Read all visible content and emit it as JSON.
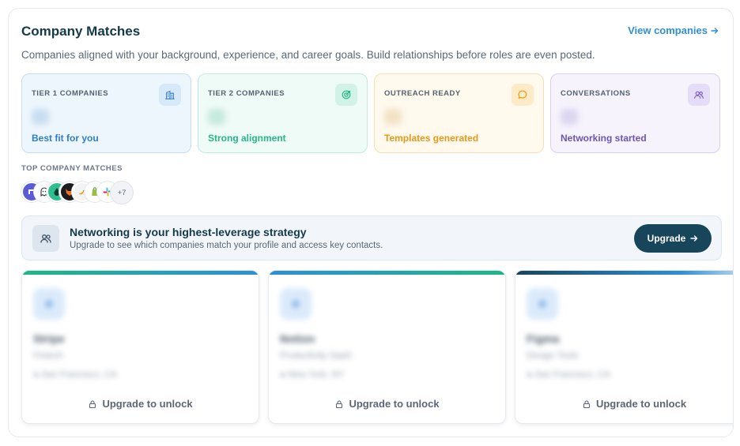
{
  "header": {
    "title": "Company Matches",
    "view_link": "View companies",
    "subtitle": "Companies aligned with your background, experience, and career goals. Build relationships before roles are even posted."
  },
  "stats": [
    {
      "label": "TIER 1 COMPANIES",
      "caption": "Best fit for you",
      "icon": "building-icon",
      "color": "#2d7fc4"
    },
    {
      "label": "TIER 2 COMPANIES",
      "caption": "Strong alignment",
      "icon": "target-icon",
      "color": "#26b886"
    },
    {
      "label": "OUTREACH READY",
      "caption": "Templates generated",
      "icon": "chat-bubble-icon",
      "color": "#e39a1a"
    },
    {
      "label": "CONVERSATIONS",
      "caption": "Networking started",
      "icon": "users-icon",
      "color": "#6f54b8"
    }
  ],
  "top_matches": {
    "label": "TOP COMPANY MATCHES",
    "more": "+7",
    "logos": [
      "linear-logo-icon",
      "ghost-logo-icon",
      "drop-logo-icon",
      "fox-logo-icon",
      "bird-logo-icon",
      "shopify-logo-icon",
      "slack-logo-icon"
    ]
  },
  "banner": {
    "title": "Networking is your highest-leverage strategy",
    "subtitle": "Upgrade to see which companies match your profile and access key contacts.",
    "button": "Upgrade"
  },
  "companies": [
    {
      "name": "Stripe",
      "category": "Fintech",
      "location": "San Francisco, CA",
      "lock": "Upgrade to unlock"
    },
    {
      "name": "Notion",
      "category": "Productivity SaaS",
      "location": "New York, NY",
      "lock": "Upgrade to unlock"
    },
    {
      "name": "Figma",
      "category": "Design Tools",
      "location": "San Francisco, CA",
      "lock": "Upgrade to unlock"
    }
  ]
}
